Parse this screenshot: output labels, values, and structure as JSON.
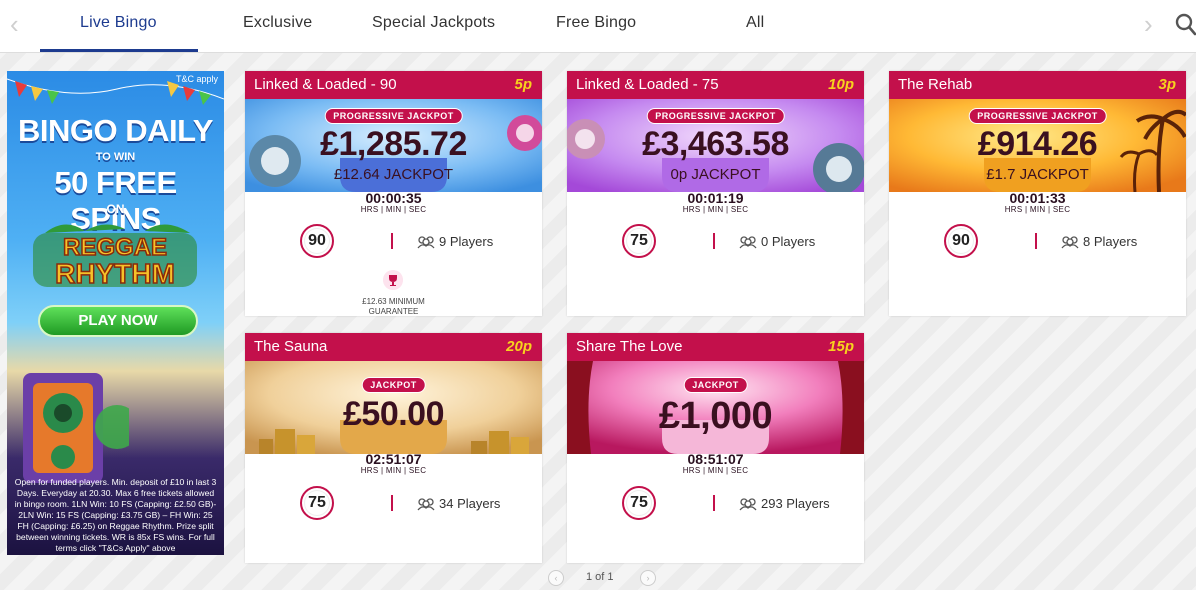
{
  "nav": {
    "tabs": [
      {
        "label": "Live Bingo",
        "active": true
      },
      {
        "label": "Exclusive"
      },
      {
        "label": "Special Jackpots"
      },
      {
        "label": "Free Bingo"
      },
      {
        "label": "All"
      }
    ],
    "left_arrow": "‹",
    "right_arrow": "›"
  },
  "promo": {
    "tc": "T&C apply",
    "headline1": "BINGO DAILY",
    "to_win": "TO WIN",
    "headline2": "50 FREE SPINS",
    "on": "ON",
    "game_line1": "REGGAE",
    "game_line2": "RHYTHM",
    "button": "PLAY NOW",
    "terms": "Open for funded players. Min. deposit of £10 in last 3 Days. Everyday at 20.30. Max 6 free tickets allowed in bingo room. 1LN Win: 10 FS (Capping: £2.50 GB)- 2LN Win: 15 FS (Capping: £3.75 GB) – FH Win: 25 FH (Capping: £6.25) on Reggae Rhythm. Prize split between winning tickets. WR is 85x FS wins. For full terms click \"T&Cs Apply\" above"
  },
  "cards": [
    {
      "title": "Linked & Loaded - 90",
      "price": "5p",
      "badge": "PROGRESSIVE JACKPOT",
      "amount": "£1,285.72",
      "sub": "£12.64 JACKPOT",
      "timer": "00:00:35",
      "timer_label": "HRS | MIN | SEC",
      "ball": "90",
      "players": "9 Players",
      "guarantee": "£12.63 MINIMUM GUARANTEE",
      "theme_color": "#3d8fe0"
    },
    {
      "title": "Linked & Loaded - 75",
      "price": "10p",
      "badge": "PROGRESSIVE JACKPOT",
      "amount": "£3,463.58",
      "sub": "0p JACKPOT",
      "timer": "00:01:19",
      "timer_label": "HRS | MIN | SEC",
      "ball": "75",
      "players": "0 Players",
      "theme_color": "#a449d8"
    },
    {
      "title": "The Rehab",
      "price": "3p",
      "badge": "PROGRESSIVE JACKPOT",
      "amount": "£914.26",
      "sub": "£1.7 JACKPOT",
      "timer": "00:01:33",
      "timer_label": "HRS | MIN | SEC",
      "ball": "90",
      "players": "8 Players",
      "theme_color": "#f49a1a"
    },
    {
      "title": "The Sauna",
      "price": "20p",
      "badge": "JACKPOT",
      "amount": "£50.00",
      "timer": "02:51:07",
      "timer_label": "HRS | MIN | SEC",
      "ball": "75",
      "players": "34 Players",
      "theme_color": "#e8b86a"
    },
    {
      "title": "Share The Love",
      "price": "15p",
      "badge": "JACKPOT",
      "amount": "£1,000",
      "timer": "08:51:07",
      "timer_label": "HRS | MIN | SEC",
      "ball": "75",
      "players": "293 Players",
      "theme_color": "#e85aa6"
    }
  ],
  "pager": {
    "text": "1 of 1"
  },
  "colors": {
    "brand": "#c3104b",
    "nav_active": "#1d3b8f",
    "price": "#f7d21e"
  }
}
